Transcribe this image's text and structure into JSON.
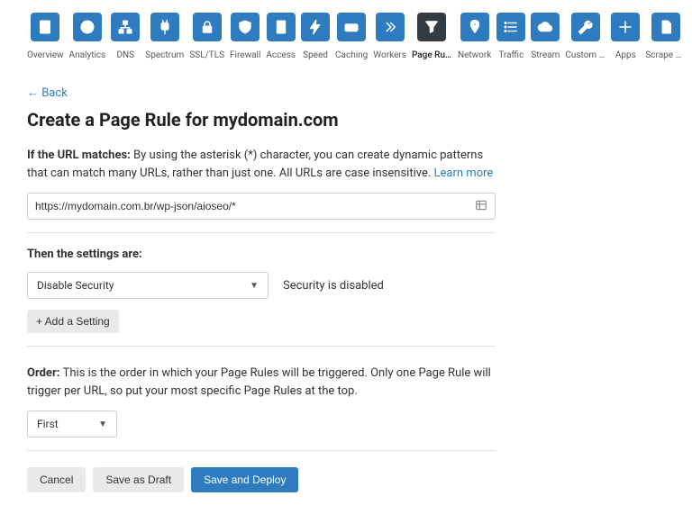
{
  "nav": [
    {
      "label": "Overview",
      "icon": "doc-icon"
    },
    {
      "label": "Analytics",
      "icon": "pie-icon"
    },
    {
      "label": "DNS",
      "icon": "sitemap-icon"
    },
    {
      "label": "Spectrum",
      "icon": "plug-icon"
    },
    {
      "label": "SSL/TLS",
      "icon": "lock-icon"
    },
    {
      "label": "Firewall",
      "icon": "shield-icon"
    },
    {
      "label": "Access",
      "icon": "door-icon"
    },
    {
      "label": "Speed",
      "icon": "bolt-icon"
    },
    {
      "label": "Caching",
      "icon": "drive-icon"
    },
    {
      "label": "Workers",
      "icon": "chevrons-icon"
    },
    {
      "label": "Page Rules",
      "icon": "funnel-icon",
      "active": true
    },
    {
      "label": "Network",
      "icon": "pin-icon"
    },
    {
      "label": "Traffic",
      "icon": "list-icon"
    },
    {
      "label": "Stream",
      "icon": "cloud-icon"
    },
    {
      "label": "Custom P…",
      "icon": "wrench-icon"
    },
    {
      "label": "Apps",
      "icon": "plus-icon"
    },
    {
      "label": "Scrape S…",
      "icon": "file-icon"
    }
  ],
  "back_label": "←  Back",
  "title": "Create a Page Rule for mydomain.com",
  "url_section": {
    "lead": "If the URL matches: ",
    "body": "By using the asterisk (*) character, you can create dynamic patterns that can match many URLs, rather than just one. All URLs are case insensitive. ",
    "learn": "Learn more"
  },
  "url_value": "https://mydomain.com.br/wp-json/aioseo/*",
  "settings_head": "Then the settings are:",
  "settings": {
    "select_value": "Disable Security",
    "status": "Security is disabled",
    "add_label": "+ Add a Setting"
  },
  "order": {
    "lead": "Order: ",
    "body": "This is the order in which your Page Rules will be triggered. Only one Page Rule will trigger per URL, so put your most specific Page Rules at the top.",
    "select_value": "First"
  },
  "actions": {
    "cancel": "Cancel",
    "draft": "Save as Draft",
    "deploy": "Save and Deploy"
  }
}
